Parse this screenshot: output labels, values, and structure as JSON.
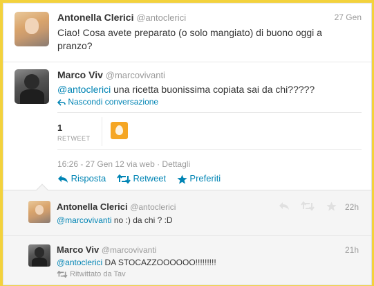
{
  "tweet1": {
    "name": "Antonella Clerici",
    "handle": "@antoclerici",
    "time": "27 Gen",
    "text": "Ciao! Cosa avete preparato (o solo mangiato) di buono oggi a pranzo?"
  },
  "tweet2": {
    "name": "Marco Viv",
    "handle": "@marcovivanti",
    "mention": "@antoclerici",
    "text": " una ricetta buonissima copiata sai da chi?????",
    "hide_conversation": "Nascondi conversazione",
    "retweet_count": "1",
    "retweet_label": "RETWEET",
    "meta": "16:26 - 27 Gen 12 via web · Dettagli",
    "actions": {
      "reply": "Risposta",
      "retweet": "Retweet",
      "favorite": "Preferiti"
    }
  },
  "reply1": {
    "name": "Antonella Clerici",
    "handle": "@antoclerici",
    "time": "22h",
    "mention": "@marcovivanti",
    "text": " no :) da chi ? :D"
  },
  "reply2": {
    "name": "Marco Viv",
    "handle": "@marcovivanti",
    "time": "21h",
    "mention": "@antoclerici",
    "text": " DA STOCAZZOOOOOO!!!!!!!!!",
    "retweeted_by": "Ritwittato da Tav"
  },
  "colors": {
    "link": "#0084b4",
    "background": "#f3d23c",
    "egg_avatar": "#f5a623"
  }
}
